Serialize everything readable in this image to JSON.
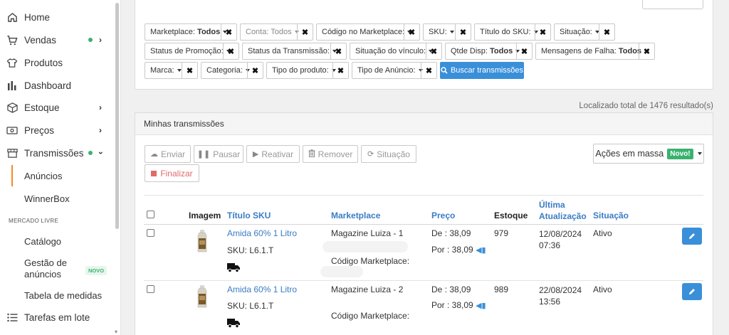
{
  "sidebar": {
    "items": [
      {
        "label": "Home",
        "icon": "home-icon"
      },
      {
        "label": "Vendas",
        "icon": "cart-icon"
      },
      {
        "label": "Produtos",
        "icon": "shirt-icon"
      },
      {
        "label": "Dashboard",
        "icon": "bar-chart-icon"
      },
      {
        "label": "Estoque",
        "icon": "box-icon"
      },
      {
        "label": "Preços",
        "icon": "money-icon"
      },
      {
        "label": "Transmissões",
        "icon": "store-icon"
      }
    ],
    "sub_transmissoes": [
      "Anúncios",
      "WinnerBox"
    ],
    "section_title": "MERCADO LIVRE",
    "sub_mercado_livre": [
      "Catálogo",
      "Gestão de anúncios",
      "Tabela de medidas"
    ],
    "gestao_line1": "Gestão de",
    "gestao_line2": "anúncios",
    "new_badge": "NOVO",
    "tarefas": "Tarefas em lote",
    "accent_color": "#f28c28",
    "dot_color": "#3ab26f"
  },
  "filters": {
    "marketplace_label": "Marketplace:",
    "marketplace_value": "Todos",
    "conta": "Conta: Todos",
    "codigo_marketplace": "Código no Marketplace:",
    "sku": "SKU:",
    "titulo_sku": "Título do SKU:",
    "situacao": "Situação:",
    "status_promocao": "Status de Promoção:",
    "status_transmissao": "Status da Transmissão:",
    "situacao_vinculo": "Situação do vínculo:",
    "qtde_disp_label": "Qtde Disp:",
    "qtde_disp_value": "Todos",
    "mensagens_falha_label": "Mensagens de Falha:",
    "mensagens_falha_value": "Todos",
    "marca": "Marca:",
    "categoria": "Categoria:",
    "tipo_produto": "Tipo do produto:",
    "tipo_anuncio": "Tipo de Anúncio:",
    "search_button": "Buscar transmissões",
    "remove_glyph": "✖"
  },
  "results_summary": "Localizado total de 1476 resultado(s)",
  "panel_title": "Minhas transmissões",
  "toolbar": {
    "enviar": "Enviar",
    "pausar": "Pausar",
    "reativar": "Reativar",
    "remover": "Remover",
    "situacao": "Situação",
    "finalizar": "Finalizar",
    "acoes_em_massa": "Ações em massa",
    "novo_badge": "Novo!"
  },
  "table": {
    "headers": {
      "imagem": "Imagem",
      "titulo_sku": "Título SKU",
      "marketplace": "Marketplace",
      "preco": "Preço",
      "estoque": "Estoque",
      "ultima_1": "Última",
      "ultima_2": "Atualização",
      "situacao": "Situação"
    },
    "rows": [
      {
        "title": "Amida 60% 1 Litro",
        "sku": "SKU: L6.1.T",
        "marketplace": "Magazine Luiza - 1",
        "codigo": "Código Marketplace:",
        "de": "De : 38,09",
        "por": "Por : 38,09",
        "estoque": "979",
        "date": "12/08/2024",
        "time": "07:36",
        "situacao": "Ativo"
      },
      {
        "title": "Amida 60% 1 Litro",
        "sku": "SKU: L6.1.T",
        "marketplace": "Magazine Luiza - 2",
        "codigo": "Código Marketplace:",
        "de": "De : 38,09",
        "por": "Por : 38,09",
        "estoque": "989",
        "date": "22/08/2024",
        "time": "13:56",
        "situacao": "Ativo"
      }
    ]
  },
  "colors": {
    "primary": "#3a8fd9",
    "link": "#3a7cc4",
    "danger": "#e06b6b",
    "success": "#3ab26f"
  }
}
